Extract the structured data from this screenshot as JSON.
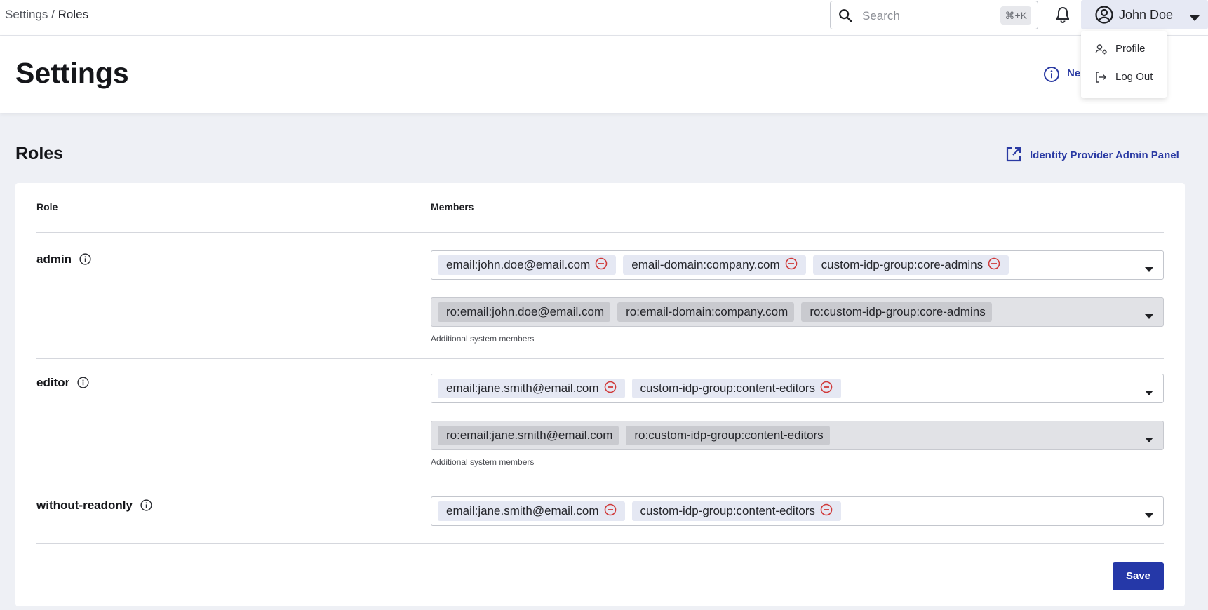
{
  "breadcrumb": {
    "parent": "Settings",
    "separator": " / ",
    "current": "Roles"
  },
  "search": {
    "placeholder": "Search",
    "shortcut": "⌘+K"
  },
  "user": {
    "name": "John Doe"
  },
  "user_menu": {
    "items": [
      {
        "label": "Profile",
        "icon": "user-settings-icon"
      },
      {
        "label": "Log Out",
        "icon": "logout-icon"
      }
    ]
  },
  "page": {
    "title": "Settings",
    "header_link": "Ne"
  },
  "roles_section": {
    "title": "Roles",
    "idp_link": "Identity Provider Admin Panel",
    "columns": {
      "role": "Role",
      "members": "Members"
    },
    "helper_text": "Additional system members",
    "save_label": "Save",
    "roles": [
      {
        "name": "admin",
        "members": [
          "email:john.doe@email.com",
          "email-domain:company.com",
          "custom-idp-group:core-admins"
        ],
        "system_members": [
          "ro:email:john.doe@email.com",
          "ro:email-domain:company.com",
          "ro:custom-idp-group:core-admins"
        ]
      },
      {
        "name": "editor",
        "members": [
          "email:jane.smith@email.com",
          "custom-idp-group:content-editors"
        ],
        "system_members": [
          "ro:email:jane.smith@email.com",
          "ro:custom-idp-group:content-editors"
        ]
      },
      {
        "name": "without-readonly",
        "members": [
          "email:jane.smith@email.com",
          "custom-idp-group:content-editors"
        ],
        "system_members": []
      }
    ]
  },
  "colors": {
    "accent": "#2538a8",
    "link": "#2a3aa3",
    "remove": "#d03a3a",
    "chip": "#e5e8f3",
    "readonly_chip": "#c9cacf"
  }
}
